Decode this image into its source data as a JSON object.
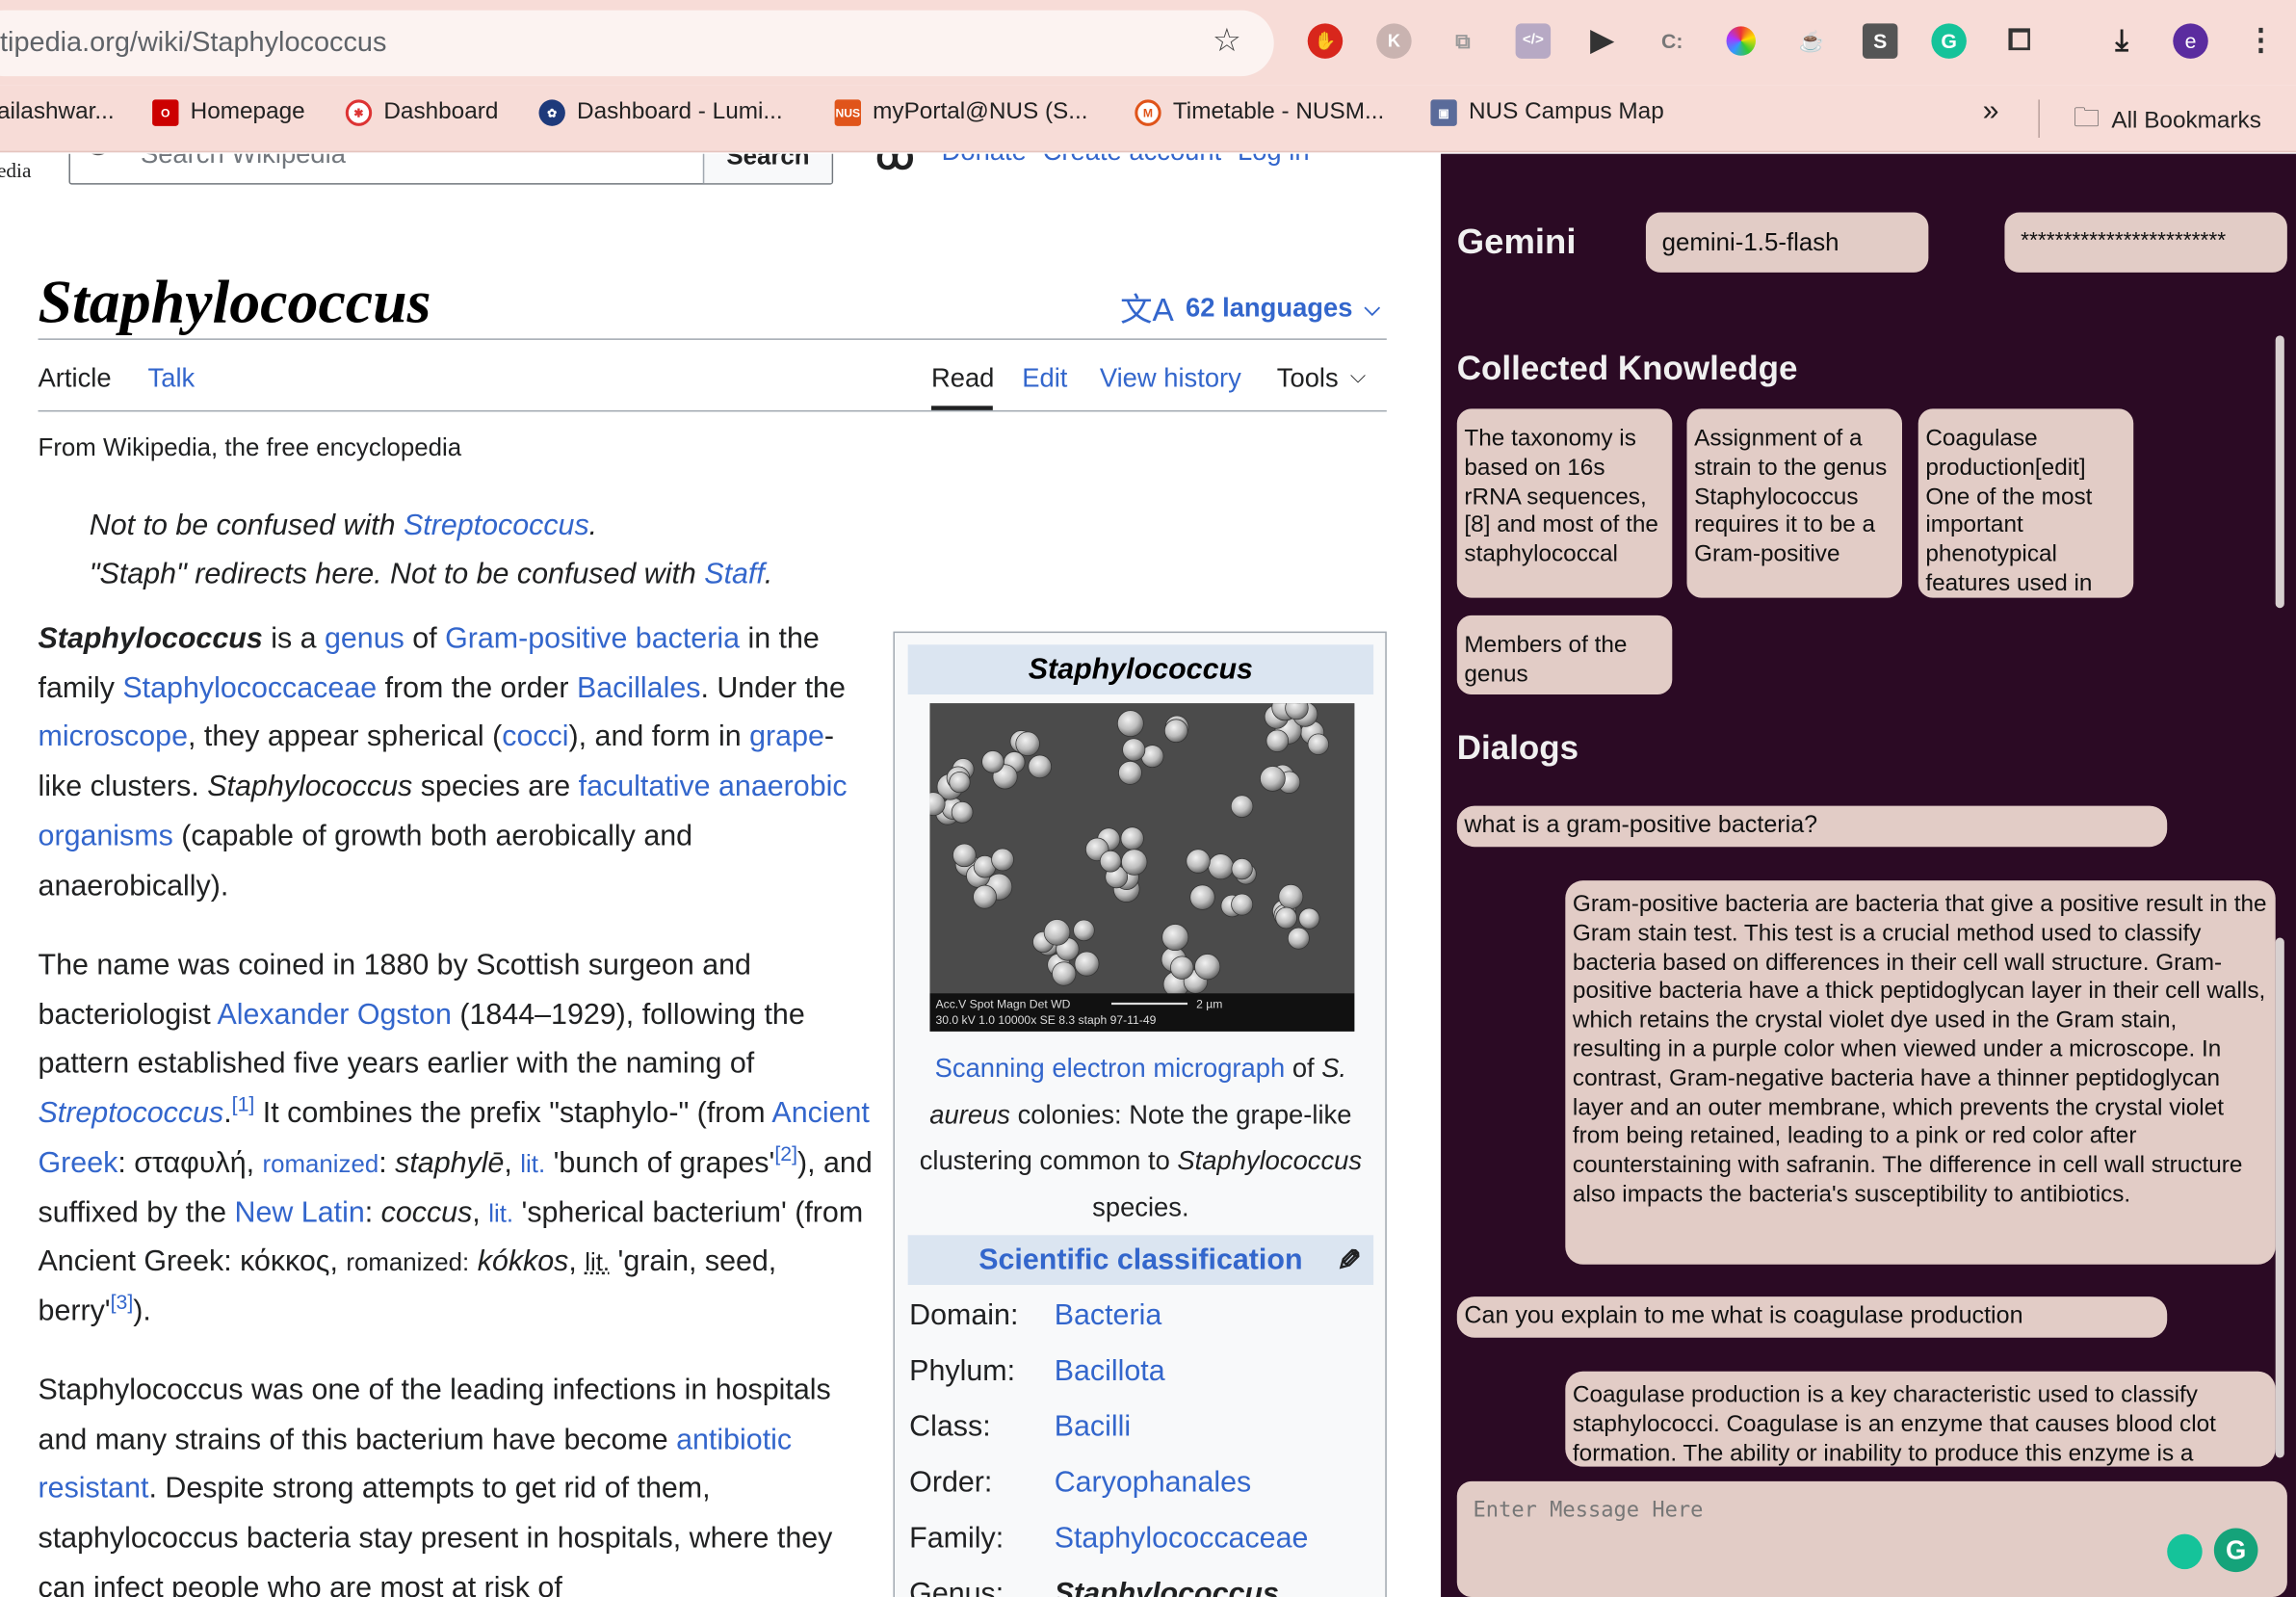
{
  "browser": {
    "url_prefix": "tipedia.org",
    "url_path": "/wiki/Staphylococcus",
    "profile_initial": "e",
    "bookmarks": [
      {
        "label": "ailashwar..."
      },
      {
        "label": "Homepage"
      },
      {
        "label": "Dashboard"
      },
      {
        "label": "Dashboard - Lumi..."
      },
      {
        "label": "myPortal@NUS (S..."
      },
      {
        "label": "Timetable - NUSM..."
      },
      {
        "label": "NUS Campus Map"
      }
    ],
    "more_bookmarks": "»",
    "all_bookmarks": "All Bookmarks"
  },
  "wiki": {
    "site_label": "edia",
    "search_placeholder": "Search Wikipedia",
    "search_button": "Search",
    "nav_donate": "Donate",
    "nav_create": "Create account",
    "nav_login": "Log in",
    "title": "Staphylococcus",
    "languages": "62 languages",
    "tabs": {
      "article": "Article",
      "talk": "Talk",
      "read": "Read",
      "edit": "Edit",
      "history": "View history",
      "tools": "Tools"
    },
    "from": "From Wikipedia, the free encyclopedia",
    "hatnote1": {
      "pre": "Not to be confused with ",
      "link": "Streptococcus",
      "post": "."
    },
    "hatnote2": {
      "pre": "\"Staph\" redirects here. Not to be confused with ",
      "link": "Staff",
      "post": "."
    },
    "infobox": {
      "title": "Staphylococcus",
      "image_bar_line1": "Acc.V   Spot Magn    Det  WD",
      "image_bar_line2": "30.0 kV 1.0   10000x  SE   8.3    staph 97-11-49",
      "image_scale": "2 µm",
      "caption_link": "Scanning electron micrograph",
      "caption_of": " of ",
      "caption_species": "S. aureus",
      "caption_rest": " colonies: Note the grape-like clustering common to ",
      "caption_genus": "Staphylococcus",
      "caption_end": " species.",
      "sci_class": "Scientific classification",
      "rows": [
        {
          "label": "Domain:",
          "value": "Bacteria"
        },
        {
          "label": "Phylum:",
          "value": "Bacillota"
        },
        {
          "label": "Class:",
          "value": "Bacilli"
        },
        {
          "label": "Order:",
          "value": "Caryophanales"
        },
        {
          "label": "Family:",
          "value": "Staphylococcaceae"
        },
        {
          "label": "Genus:",
          "value": "Staphylococcus"
        }
      ]
    }
  },
  "gemini": {
    "title": "Gemini",
    "model": "gemini-1.5-flash",
    "api_key": "************************",
    "knowledge_title": "Collected Knowledge",
    "knowledge": [
      "The taxonomy is based on 16s rRNA sequences,[8] and most of the staphylococcal",
      "Assignment of a strain to the genus Staphylococcus requires it to be a Gram-positive",
      "Coagulase production[edit] One of the most important phenotypical features used in",
      "Members of the genus"
    ],
    "dialogs_title": "Dialogs",
    "messages": [
      {
        "role": "user",
        "text": "what is a gram-positive bacteria?"
      },
      {
        "role": "model",
        "text": "Gram-positive bacteria are bacteria that give a positive result in the Gram stain test. This test is a crucial method used to classify bacteria based on differences in their cell wall structure. Gram-positive bacteria have a thick peptidoglycan layer in their cell walls, which retains the crystal violet dye used in the Gram stain, resulting in a purple color when viewed under a microscope. In contrast, Gram-negative bacteria have a thinner peptidoglycan layer and an outer membrane, which prevents the crystal violet from being retained, leading to a pink or red color after counterstaining with safranin. The difference in cell wall structure also impacts the bacteria's susceptibility to antibiotics."
      },
      {
        "role": "user",
        "text": "Can you explain to me what is coagulase production"
      },
      {
        "role": "model",
        "text": "Coagulase production is a key characteristic used to classify staphylococci. Coagulase is an enzyme that causes blood clot formation. The ability or inability to produce this enzyme is a"
      }
    ],
    "input_placeholder": "Enter Message Here"
  }
}
